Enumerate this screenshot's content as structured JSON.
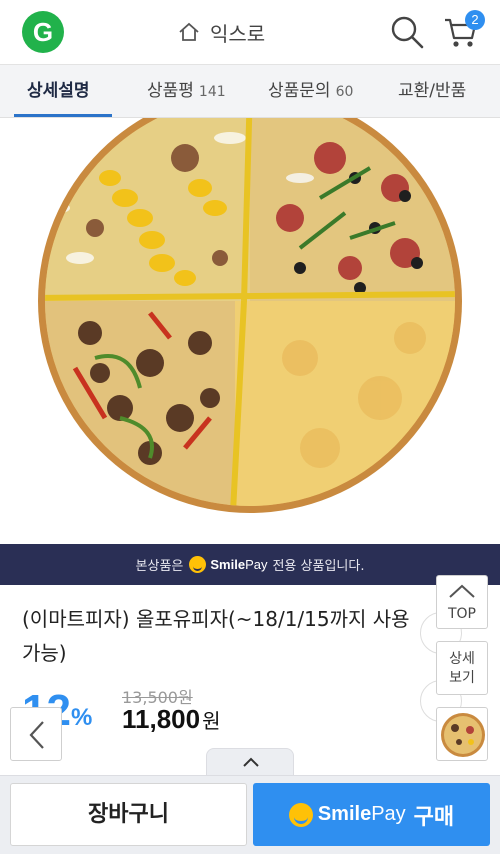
{
  "header": {
    "logo_text": "G",
    "title": "익스로",
    "cart_count": "2",
    "brand_color": "#21b24b",
    "accent_color": "#2f8ff0"
  },
  "tabs": [
    {
      "label": "상세설명",
      "count": ""
    },
    {
      "label": "상품평",
      "count": "141"
    },
    {
      "label": "상품문의",
      "count": "60"
    },
    {
      "label": "교환/반품",
      "count": ""
    }
  ],
  "banner": {
    "prefix": "본상품은",
    "brand_smile": "Smile",
    "brand_pay": "Pay",
    "suffix": "전용 상품입니다."
  },
  "product": {
    "title": "(이마트피자) 올포유피자(~18/1/15까지 사용가능)",
    "discount_number": "12",
    "discount_percent": "%",
    "original_price": "13,500원",
    "sale_price": "11,800",
    "sale_currency": "원"
  },
  "floating": {
    "top_label": "TOP",
    "detail_label_1": "상세",
    "detail_label_2": "보기"
  },
  "bottom": {
    "cart_label": "장바구니",
    "buy_smile": "Smile",
    "buy_pay": "Pay",
    "buy_label": "구매"
  },
  "icons": {
    "home": "home-icon",
    "search": "search-icon",
    "cart": "cart-icon",
    "back": "chevron-left-icon",
    "handle": "chevron-up-icon"
  }
}
